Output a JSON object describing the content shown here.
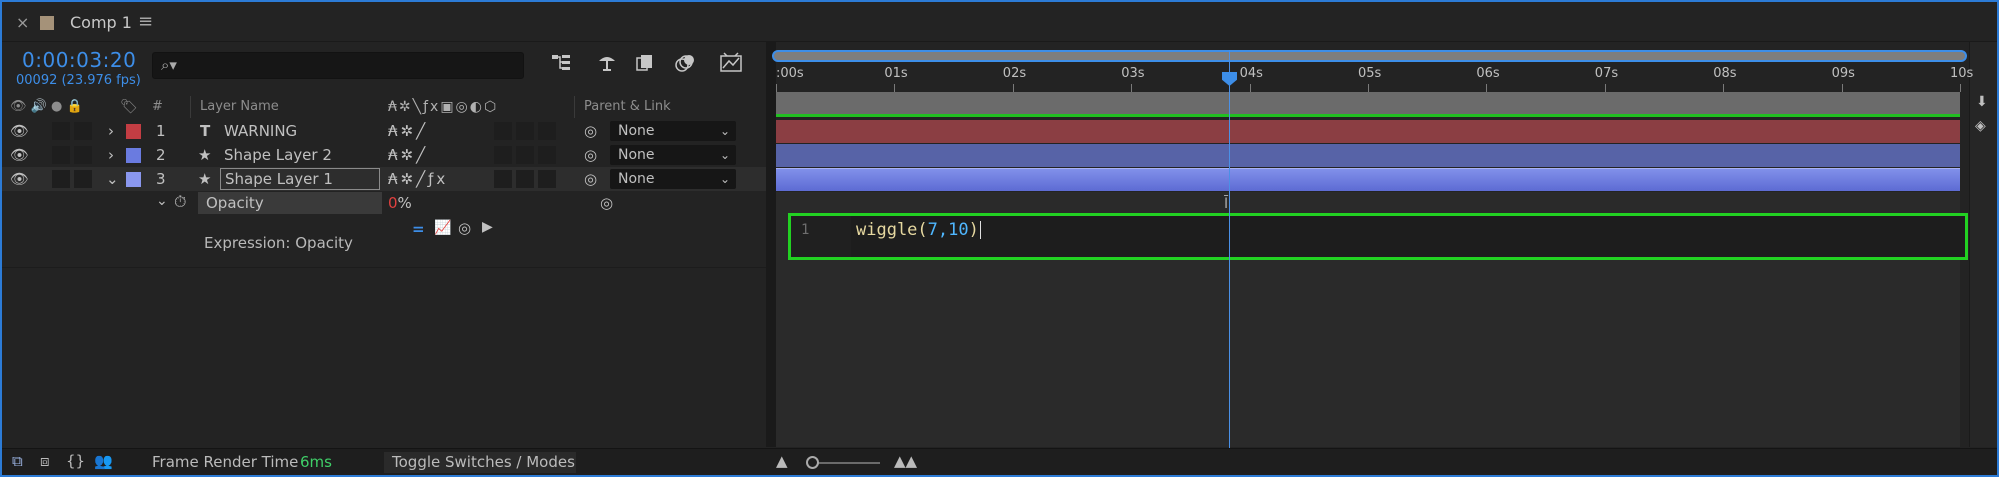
{
  "tab": {
    "close": "×",
    "title": "Comp 1",
    "menu": "≡",
    "swatch_color": "#a59279"
  },
  "header": {
    "timecode": "0:00:03:20",
    "frames": "00092 (23.976 fps)",
    "search_placeholder": ""
  },
  "toolbar": {
    "icons": [
      "comp-mini-flowchart-icon",
      "draft-3d-icon",
      "frame-blending-icon",
      "motion-blur-icon",
      "graph-editor-icon"
    ]
  },
  "columns": {
    "number": "#",
    "layer_name": "Layer Name",
    "parent": "Parent & Link"
  },
  "layers": [
    {
      "index": "1",
      "type_glyph": "T",
      "name": "WARNING",
      "color": "#c33d43",
      "parent": "None",
      "expanded": false
    },
    {
      "index": "2",
      "type_glyph": "★",
      "name": "Shape Layer 2",
      "color": "#6a7be0",
      "parent": "None",
      "expanded": false
    },
    {
      "index": "3",
      "type_glyph": "★",
      "name": "Shape Layer 1",
      "color": "#8a97ee",
      "parent": "None",
      "expanded": true
    }
  ],
  "property": {
    "name": "Opacity",
    "value": "0",
    "unit": "%"
  },
  "expression": {
    "label": "Expression: Opacity",
    "line_number": "1",
    "fn": "wiggle(",
    "arg1": "7",
    "comma": ",",
    "arg2": "10",
    "close": ")"
  },
  "ruler": {
    "ticks": [
      ":00s",
      "01s",
      "02s",
      "03s",
      "04s",
      "05s",
      "06s",
      "07s",
      "08s",
      "09s",
      "10s"
    ]
  },
  "footer": {
    "render_label": "Frame Render Time",
    "render_value": "6ms",
    "toggle_label": "Toggle Switches / Modes"
  },
  "colors": {
    "accent": "#3d8ee8",
    "highlight": "#22d122"
  }
}
